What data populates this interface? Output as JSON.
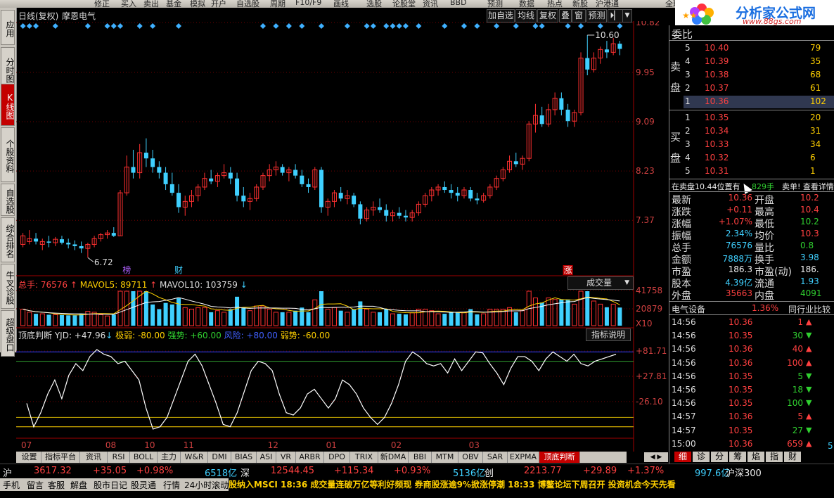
{
  "top_menu": [
    "修正",
    "买入",
    "卖出",
    "基金",
    "模拟",
    "开户",
    "自选股",
    "周期",
    "F10/F9",
    "画线",
    "选股",
    "论股堂",
    "资讯",
    "BBD",
    "预测",
    "数据",
    "热点",
    "新股",
    "沪港通",
    "全球"
  ],
  "left_tabs": [
    {
      "label": "应用",
      "active": false
    },
    {
      "label": "分时图",
      "active": false
    },
    {
      "label": "K线图",
      "active": true
    },
    {
      "label": "个股资料",
      "active": false
    },
    {
      "label": "自选股",
      "active": false
    },
    {
      "label": "综合排名",
      "active": false
    },
    {
      "label": "牛叉诊股",
      "active": false
    },
    {
      "label": "超级盘口",
      "active": false
    }
  ],
  "chart_header": {
    "mode": "日线(复权)",
    "stock_name": "摩恩电气",
    "buttons": [
      "加自选",
      "均线",
      "复权",
      "叠",
      "窗",
      "预测",
      "⏵▏"
    ]
  },
  "price_axis": [
    "10.82",
    "9.95",
    "9.09",
    "8.23",
    "7.37"
  ],
  "price_annotations": {
    "high": "10.60",
    "low": "6.72"
  },
  "event_markers": [
    {
      "label": "榜",
      "color": "#b060ff"
    },
    {
      "label": "财",
      "color": "#3fd0ff"
    },
    {
      "label": "涨",
      "color": "#fff",
      "bg": "#c00000"
    }
  ],
  "volume_header": {
    "total": "总手: 76576",
    "mavol5": "MAVOL5: 89711",
    "mavol10": "MAVOL10: 103759",
    "selector": "成交量"
  },
  "volume_axis": [
    "41758",
    "20879",
    "X10"
  ],
  "indicator_header": {
    "name": "顶底判断",
    "yjd": "YJD: +47.96",
    "weak": "极弱: -80.00",
    "strong": "强势: +60.00",
    "risk": "风险: +80.00",
    "weakness": "弱势: -60.00",
    "explain": "指标说明"
  },
  "indicator_axis": [
    "+81.71",
    "+27.81",
    "-26.10"
  ],
  "x_axis": [
    "07",
    "08",
    "10",
    "11",
    "12",
    "01",
    "02",
    "03"
  ],
  "bottom_tabs": [
    "设置",
    "指标平台",
    "资讯",
    "RSI",
    "BOLL",
    "主力",
    "W&R",
    "DMI",
    "BIAS",
    "ASI",
    "VR",
    "ARBR",
    "DPO",
    "TRIX",
    "新DMA",
    "BBI",
    "MTM",
    "OBV",
    "SAR",
    "EXPMA",
    "顶底判断"
  ],
  "order_book": {
    "ratio_label": "委比",
    "sell": [
      {
        "n": "5",
        "p": "10.40",
        "v": "79"
      },
      {
        "n": "4",
        "p": "10.39",
        "v": "35"
      },
      {
        "n": "3",
        "p": "10.38",
        "v": "68"
      },
      {
        "n": "2",
        "p": "10.37",
        "v": "61"
      },
      {
        "n": "1",
        "p": "10.36",
        "v": "102"
      }
    ],
    "buy": [
      {
        "n": "1",
        "p": "10.35",
        "v": "20"
      },
      {
        "n": "2",
        "p": "10.34",
        "v": "31"
      },
      {
        "n": "3",
        "p": "10.33",
        "v": "34"
      },
      {
        "n": "4",
        "p": "10.32",
        "v": "6"
      },
      {
        "n": "5",
        "p": "10.31",
        "v": "1"
      }
    ],
    "sell_label": "卖盘",
    "buy_label": "买盘"
  },
  "notice": {
    "text": "在卖盘10.44位置有",
    "vol": "829手",
    "rest": "卖单! 查看详情"
  },
  "quote": [
    {
      "l": "最新",
      "v": "10.36",
      "c": "red",
      "l2": "开盘",
      "v2": "10.2",
      "c2": "red"
    },
    {
      "l": "涨跌",
      "v": "+0.11",
      "c": "red",
      "l2": "最高",
      "v2": "10.4",
      "c2": "red"
    },
    {
      "l": "涨幅",
      "v": "+1.07%",
      "c": "red",
      "l2": "最低",
      "v2": "10.2",
      "c2": "grn"
    },
    {
      "l": "振幅",
      "v": "2.34%",
      "c": "cyn",
      "l2": "均价",
      "v2": "10.3",
      "c2": "red"
    },
    {
      "l": "总手",
      "v": "76576",
      "c": "cyn",
      "l2": "量比",
      "v2": "0.8",
      "c2": "grn"
    },
    {
      "l": "金额",
      "v": "7888万",
      "c": "cyn",
      "l2": "换手",
      "v2": "3.98",
      "c2": "cyn"
    },
    {
      "l": "市盈",
      "v": "186.3",
      "c": "wht",
      "l2": "市盈(动)",
      "v2": "186.",
      "c2": "wht"
    },
    {
      "l": "股本",
      "v": "4.39亿",
      "c": "cyn",
      "l2": "流通",
      "v2": "1.93",
      "c2": "cyn"
    },
    {
      "l": "外盘",
      "v": "35663",
      "c": "red",
      "l2": "内盘",
      "v2": "4091",
      "c2": "grn"
    }
  ],
  "sector": {
    "name": "电气设备",
    "pct": "1.36%",
    "compare": "同行业比较"
  },
  "ticks": [
    {
      "t": "14:56",
      "p": "10.36",
      "pc": "red",
      "v": "1",
      "d": "up"
    },
    {
      "t": "14:56",
      "p": "10.35",
      "pc": "red",
      "v": "30",
      "d": "down"
    },
    {
      "t": "14:56",
      "p": "10.36",
      "pc": "red",
      "v": "40",
      "d": "up"
    },
    {
      "t": "14:56",
      "p": "10.36",
      "pc": "red",
      "v": "100",
      "d": "up"
    },
    {
      "t": "14:56",
      "p": "10.35",
      "pc": "red",
      "v": "5",
      "d": "down"
    },
    {
      "t": "14:56",
      "p": "10.35",
      "pc": "red",
      "v": "18",
      "d": "down"
    },
    {
      "t": "14:56",
      "p": "10.35",
      "pc": "red",
      "v": "100",
      "d": "down"
    },
    {
      "t": "14:57",
      "p": "10.36",
      "pc": "red",
      "v": "5",
      "d": "up"
    },
    {
      "t": "14:57",
      "p": "10.35",
      "pc": "red",
      "v": "27",
      "d": "down"
    },
    {
      "t": "15:00",
      "p": "10.36",
      "pc": "red",
      "v": "659",
      "d": "up"
    }
  ],
  "right_tabs": [
    "细",
    "诊",
    "分",
    "筹",
    "焰",
    "指",
    "财"
  ],
  "index_bar": [
    {
      "name": "沪",
      "val": "3617.32",
      "chg": "+35.05",
      "pct": "+0.98%",
      "amt": "6518亿"
    },
    {
      "name": "深",
      "val": "12544.45",
      "chg": "+115.34",
      "pct": "+0.93%",
      "amt": "5136亿"
    },
    {
      "name": "创",
      "val": "2213.77",
      "chg": "+29.89",
      "pct": "+1.37%",
      "amt": "997.6亿"
    },
    {
      "name": "沪深300",
      "val": "",
      "chg": "",
      "pct": "",
      "amt": ""
    }
  ],
  "status_left": [
    "手机",
    "留言",
    "客服",
    "解盘",
    "股市日记",
    "股灵通",
    "行情",
    "24小时滚动"
  ],
  "ticker": "股纳入MSCI    18:36 成交量连破万亿等利好频现 券商股涨逾9%掀涨停潮    18:33 博鳌论坛下周召开 投资机会今天先看",
  "logo": {
    "text": "分析家公式网",
    "url": "www.88gs.com"
  },
  "chart_data": {
    "type": "candlestick",
    "title": "摩恩电气 日线(复权)",
    "ylim": [
      6.6,
      10.82
    ],
    "candles": [
      [
        6.95,
        7.15,
        6.9,
        7.1
      ],
      [
        7.0,
        7.2,
        6.95,
        7.05
      ],
      [
        7.05,
        7.15,
        6.95,
        7.0
      ],
      [
        6.95,
        7.05,
        6.85,
        7.0
      ],
      [
        7.0,
        7.1,
        6.9,
        6.98
      ],
      [
        6.98,
        7.08,
        6.92,
        7.04
      ],
      [
        7.04,
        7.1,
        6.95,
        6.98
      ],
      [
        6.98,
        7.05,
        6.88,
        6.95
      ],
      [
        6.95,
        7.02,
        6.85,
        6.92
      ],
      [
        6.92,
        7.0,
        6.8,
        6.88
      ],
      [
        6.88,
        6.98,
        6.72,
        6.95
      ],
      [
        6.95,
        7.1,
        6.9,
        7.05
      ],
      [
        7.05,
        7.15,
        7.0,
        7.12
      ],
      [
        7.12,
        7.2,
        7.05,
        7.15
      ],
      [
        7.15,
        7.25,
        7.08,
        7.1
      ],
      [
        7.1,
        7.9,
        7.1,
        7.85
      ],
      [
        7.85,
        8.5,
        7.8,
        8.3
      ],
      [
        8.3,
        8.6,
        8.1,
        8.2
      ],
      [
        8.2,
        8.7,
        8.1,
        8.55
      ],
      [
        8.55,
        8.8,
        8.3,
        8.45
      ],
      [
        8.45,
        8.6,
        8.2,
        8.3
      ],
      [
        8.3,
        8.4,
        8.1,
        8.2
      ],
      [
        8.2,
        8.3,
        7.9,
        8.0
      ],
      [
        8.0,
        8.2,
        7.8,
        7.85
      ],
      [
        7.85,
        8.0,
        7.5,
        7.6
      ],
      [
        7.6,
        7.8,
        7.45,
        7.7
      ],
      [
        7.7,
        7.9,
        7.6,
        7.8
      ],
      [
        7.8,
        8.0,
        7.7,
        7.95
      ],
      [
        7.95,
        8.2,
        7.9,
        8.1
      ],
      [
        8.1,
        8.25,
        8.0,
        8.05
      ],
      [
        8.05,
        8.2,
        7.95,
        8.15
      ],
      [
        8.15,
        8.35,
        8.1,
        8.2
      ],
      [
        8.2,
        8.3,
        8.0,
        8.1
      ],
      [
        8.1,
        8.2,
        7.7,
        7.8
      ],
      [
        7.8,
        7.95,
        7.6,
        7.7
      ],
      [
        7.7,
        7.85,
        7.55,
        7.75
      ],
      [
        7.75,
        8.0,
        7.7,
        7.95
      ],
      [
        7.95,
        8.2,
        7.9,
        8.15
      ],
      [
        8.15,
        8.35,
        8.05,
        8.25
      ],
      [
        8.25,
        8.4,
        8.15,
        8.3
      ],
      [
        8.3,
        8.35,
        8.15,
        8.2
      ],
      [
        8.2,
        8.3,
        8.05,
        8.25
      ],
      [
        8.25,
        8.35,
        8.1,
        8.15
      ],
      [
        8.15,
        8.25,
        7.95,
        8.0
      ],
      [
        8.0,
        8.1,
        7.85,
        7.95
      ],
      [
        7.95,
        8.3,
        7.9,
        8.25
      ],
      [
        8.25,
        8.3,
        7.5,
        7.6
      ],
      [
        7.6,
        7.75,
        7.45,
        7.7
      ],
      [
        7.7,
        7.9,
        7.6,
        7.85
      ],
      [
        7.85,
        7.95,
        7.7,
        7.75
      ],
      [
        7.75,
        7.9,
        7.65,
        7.8
      ],
      [
        7.8,
        7.85,
        7.6,
        7.65
      ],
      [
        7.65,
        7.7,
        7.3,
        7.4
      ],
      [
        7.4,
        7.6,
        7.35,
        7.55
      ],
      [
        7.55,
        7.7,
        7.45,
        7.6
      ],
      [
        7.6,
        7.75,
        7.5,
        7.55
      ],
      [
        7.55,
        7.65,
        7.35,
        7.45
      ],
      [
        7.45,
        7.55,
        7.35,
        7.5
      ],
      [
        7.5,
        7.6,
        7.4,
        7.45
      ],
      [
        7.45,
        7.55,
        7.35,
        7.42
      ],
      [
        7.42,
        7.55,
        7.35,
        7.5
      ],
      [
        7.5,
        7.7,
        7.45,
        7.65
      ],
      [
        7.65,
        7.85,
        7.6,
        7.8
      ],
      [
        7.8,
        7.95,
        7.7,
        7.9
      ],
      [
        7.9,
        8.0,
        7.8,
        7.95
      ],
      [
        7.95,
        8.05,
        7.85,
        7.9
      ],
      [
        7.9,
        8.0,
        7.75,
        7.85
      ],
      [
        7.85,
        7.95,
        7.7,
        7.8
      ],
      [
        7.8,
        7.95,
        7.75,
        7.9
      ],
      [
        7.9,
        7.95,
        7.7,
        7.75
      ],
      [
        7.75,
        7.85,
        7.65,
        7.72
      ],
      [
        7.72,
        7.85,
        7.68,
        7.8
      ],
      [
        7.8,
        8.0,
        7.75,
        7.95
      ],
      [
        7.95,
        8.15,
        7.9,
        8.1
      ],
      [
        8.1,
        8.3,
        8.05,
        8.25
      ],
      [
        8.25,
        8.5,
        8.2,
        8.4
      ],
      [
        8.4,
        8.55,
        8.3,
        8.35
      ],
      [
        8.35,
        8.5,
        8.25,
        8.45
      ],
      [
        8.45,
        9.1,
        8.4,
        9.05
      ],
      [
        9.05,
        9.4,
        8.9,
        9.2
      ],
      [
        9.2,
        9.35,
        9.0,
        9.05
      ],
      [
        9.05,
        9.4,
        9.0,
        9.3
      ],
      [
        9.3,
        9.6,
        9.2,
        9.5
      ],
      [
        9.5,
        9.6,
        9.2,
        9.3
      ],
      [
        9.3,
        9.4,
        9.0,
        9.1
      ],
      [
        9.1,
        9.3,
        9.0,
        9.25
      ],
      [
        9.25,
        10.3,
        9.2,
        10.2
      ],
      [
        10.2,
        10.6,
        9.9,
        10.0
      ],
      [
        10.0,
        10.3,
        9.95,
        10.2
      ],
      [
        10.2,
        10.4,
        10.1,
        10.35
      ],
      [
        10.35,
        10.5,
        10.2,
        10.3
      ],
      [
        10.3,
        10.55,
        10.25,
        10.45
      ],
      [
        10.45,
        10.5,
        10.25,
        10.36
      ]
    ]
  }
}
